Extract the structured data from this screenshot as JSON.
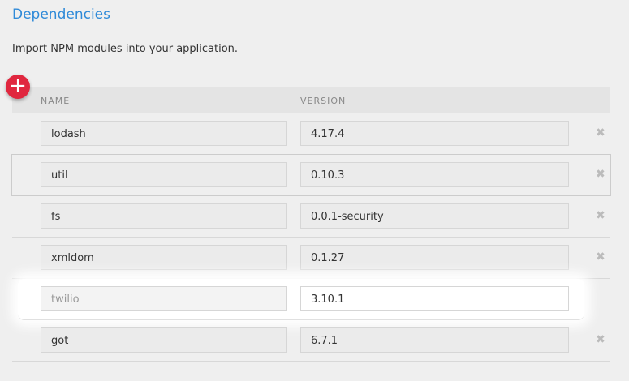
{
  "title": "Dependencies",
  "description": "Import NPM modules into your application.",
  "add_label": "+",
  "columns": {
    "name": "NAME",
    "version": "VERSION"
  },
  "remove_icon": "✖",
  "rows": [
    {
      "name": "lodash",
      "version": "4.17.4"
    },
    {
      "name": "util",
      "version": "0.10.3"
    },
    {
      "name": "fs",
      "version": "0.0.1-security"
    },
    {
      "name": "xmldom",
      "version": "0.1.27"
    },
    {
      "name": "twilio",
      "version": "3.10.1"
    },
    {
      "name": "got",
      "version": "6.7.1"
    }
  ]
}
